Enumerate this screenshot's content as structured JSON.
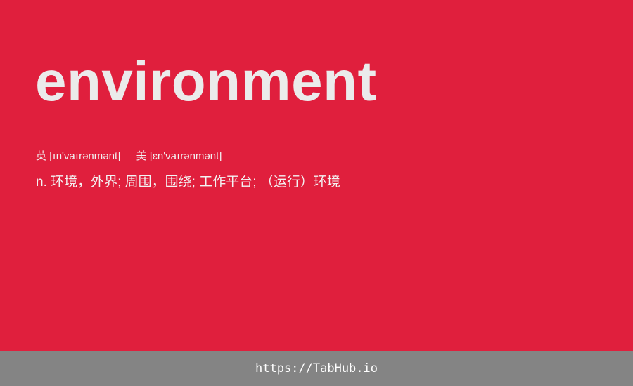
{
  "word": "environment",
  "phonetics": {
    "uk_label": "英",
    "uk_ipa": "[ɪn'vaɪrənmənt]",
    "us_label": "美",
    "us_ipa": "[ɛn'vaɪrənmənt]"
  },
  "definition": "n. 环境，外界; 周围，围绕; 工作平台; （运行）环境",
  "footer": {
    "link_text": "https://TabHub.io"
  },
  "colors": {
    "background": "#e01f3d",
    "footer_background": "#848484",
    "text": "#ebebeb"
  }
}
